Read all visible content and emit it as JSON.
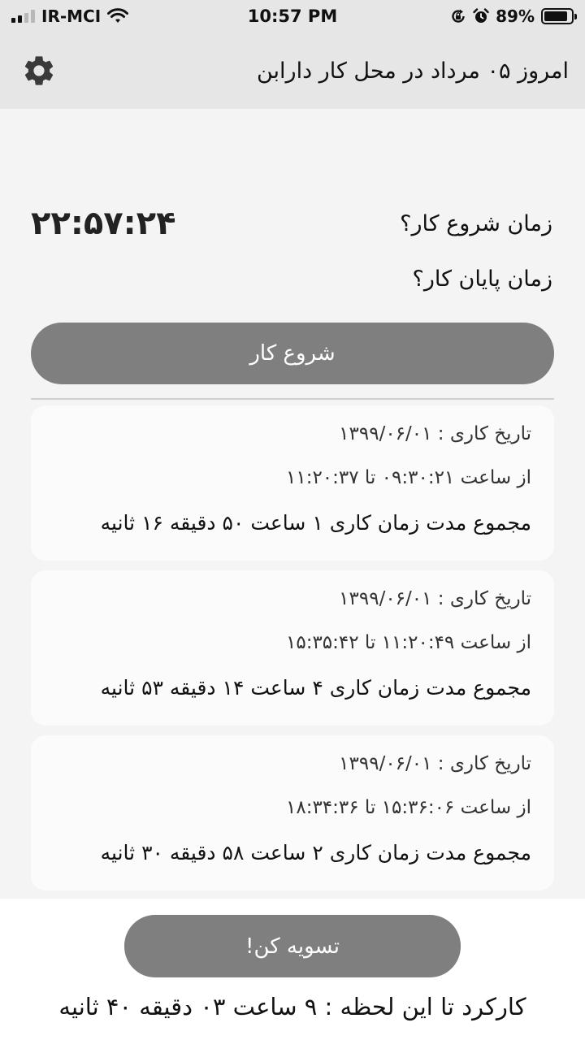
{
  "status_bar": {
    "carrier": "IR-MCI",
    "time": "10:57 PM",
    "battery_text": "89%",
    "battery_level": 0.89,
    "icons": [
      "signal-icon",
      "wifi-icon",
      "rotation-lock-icon",
      "alarm-icon",
      "battery-icon"
    ]
  },
  "header": {
    "title": "امروز ۰۵ مرداد در محل کار دارابن",
    "settings_icon": "gear-icon"
  },
  "timer": {
    "start_label": "زمان شروع کار؟",
    "clock": "۲۲:۵۷:۲۴",
    "end_label": "زمان پایان کار؟",
    "start_button": "شروع کار"
  },
  "records": [
    {
      "date_line": "تاریخ کاری : ۱۳۹۹/۰۶/۰۱",
      "range_line": "از ساعت ۰۹:۳۰:۲۱ تا ۱۱:۲۰:۳۷",
      "total_line": "مجموع مدت زمان کاری ۱ ساعت ۵۰ دقیقه ۱۶ ثانیه"
    },
    {
      "date_line": "تاریخ کاری : ۱۳۹۹/۰۶/۰۱",
      "range_line": "از ساعت ۱۱:۲۰:۴۹ تا ۱۵:۳۵:۴۲",
      "total_line": "مجموع مدت زمان کاری ۴ ساعت ۱۴ دقیقه ۵۳ ثانیه"
    },
    {
      "date_line": "تاریخ کاری : ۱۳۹۹/۰۶/۰۱",
      "range_line": "از ساعت ۱۵:۳۶:۰۶ تا ۱۸:۳۴:۳۶",
      "total_line": "مجموع مدت زمان کاری ۲ ساعت ۵۸ دقیقه ۳۰ ثانیه"
    }
  ],
  "footer": {
    "settle_button": "تسویه کن!",
    "total_so_far": "کارکرد تا این لحظه : ۹ ساعت ۰۳ دقیقه ۴۰ ثانیه"
  },
  "colors": {
    "header_bg": "#e6e6e6",
    "button_bg": "#7f7f7f",
    "card_bg": "#fbfbfb",
    "page_bg": "#f4f4f4"
  }
}
